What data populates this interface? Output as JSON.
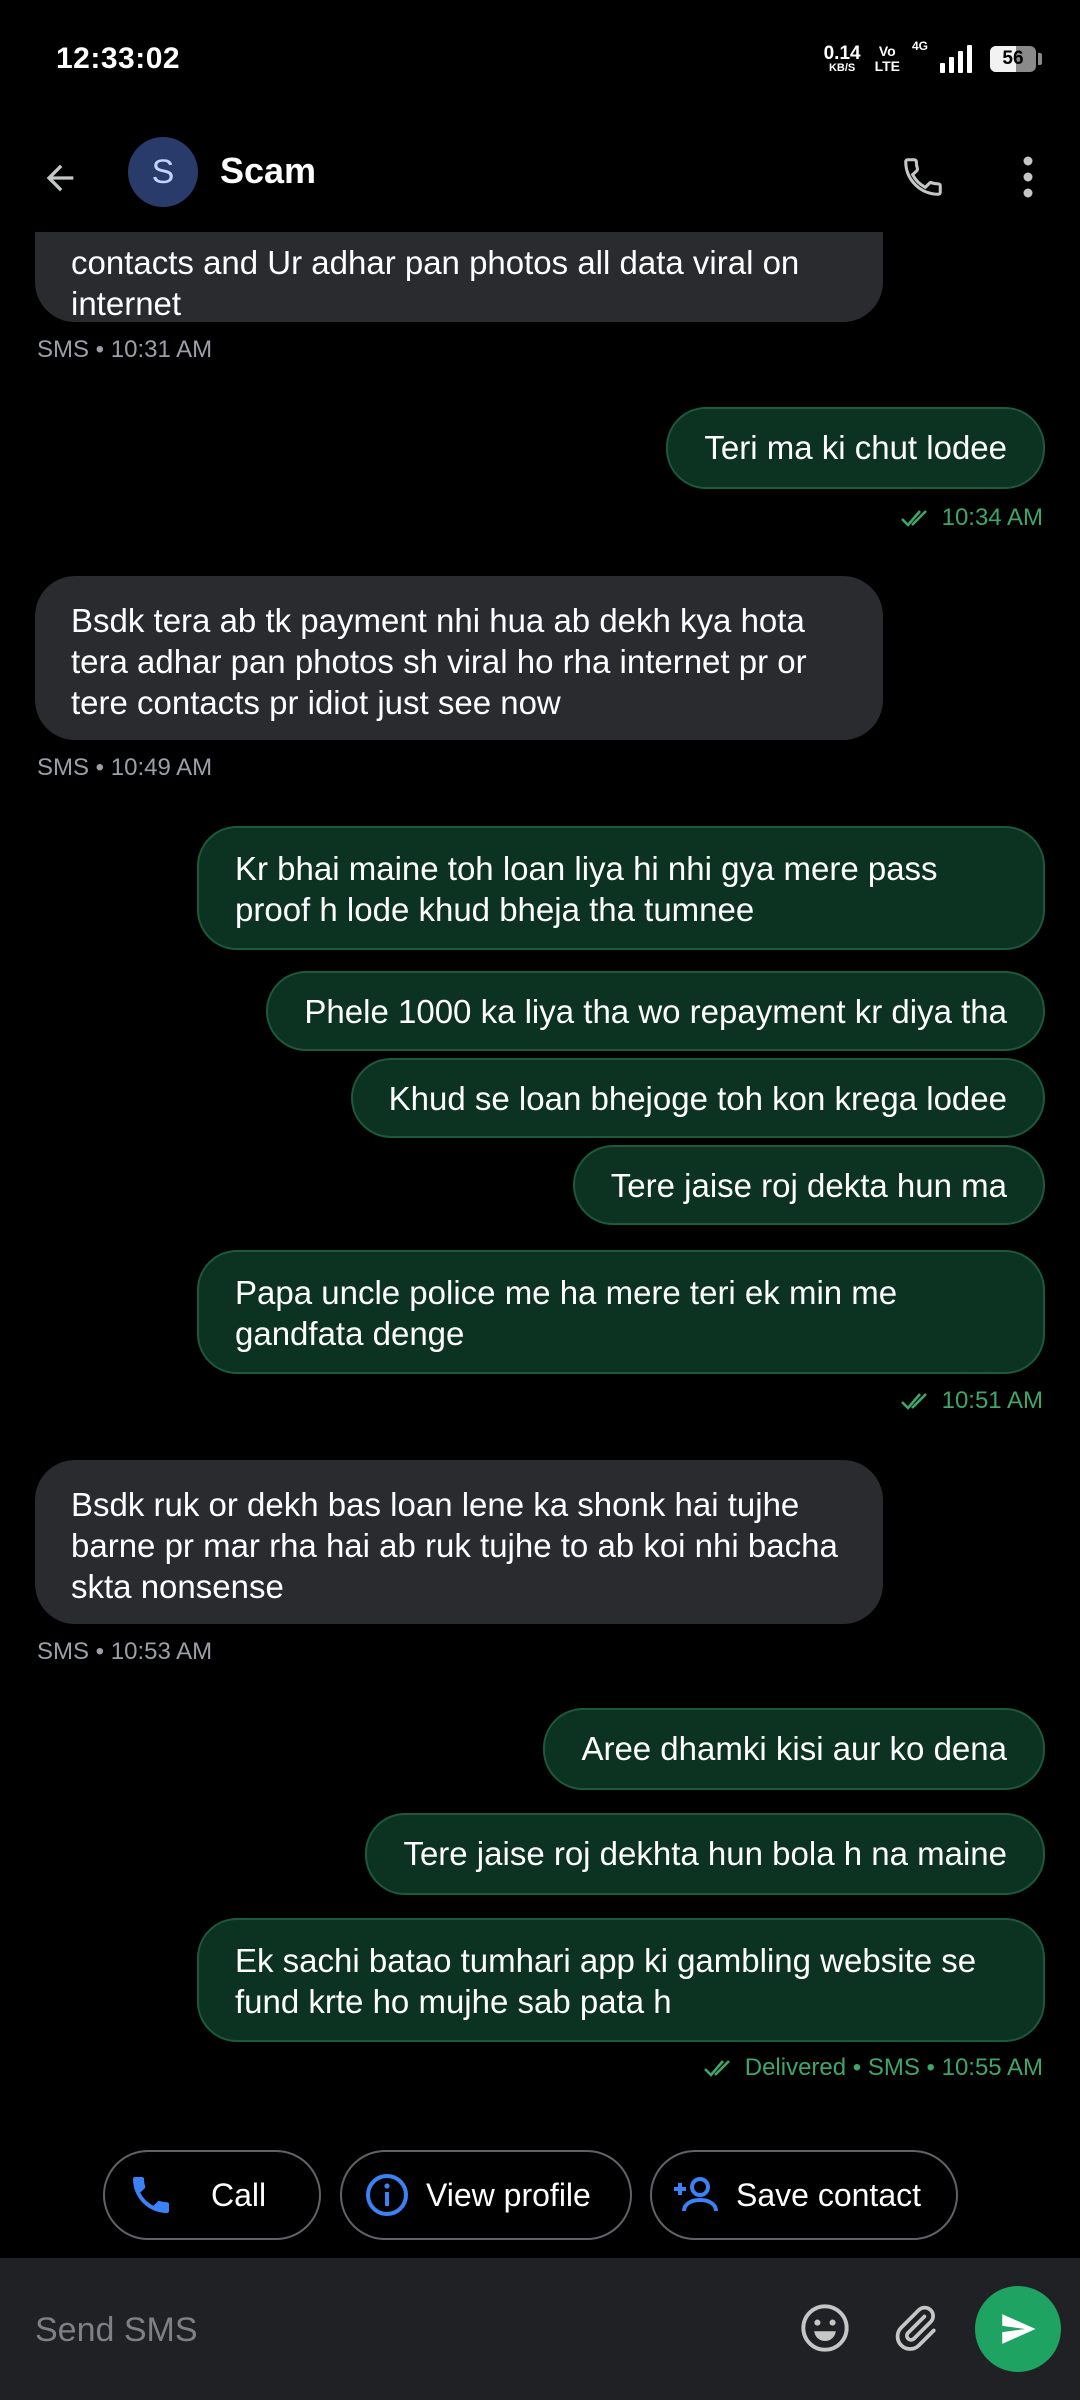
{
  "status_bar": {
    "time": "12:33:02",
    "net_speed_value": "0.14",
    "net_speed_unit": "KB/S",
    "volte_top": "Vo",
    "volte_bottom": "LTE",
    "network": "4G",
    "battery": "56",
    "battery_level": 0.56
  },
  "header": {
    "avatar_letter": "S",
    "contact_name": "Scam",
    "avatar_color": "#283b6a"
  },
  "messages": [
    {
      "direction": "in",
      "text": "contacts and Ur adhar pan photos all data viral on internet",
      "meta": "SMS • 10:31 AM"
    },
    {
      "direction": "out",
      "text": "Teri ma ki chut lodee",
      "meta": "10:34 AM"
    },
    {
      "direction": "in",
      "text": "Bsdk tera ab tk payment nhi hua ab dekh kya hota tera adhar pan photos sh viral ho rha internet pr or tere contacts pr idiot just see now",
      "meta": "SMS • 10:49 AM"
    },
    {
      "direction": "out",
      "text": "Kr bhai maine toh loan liya hi nhi gya mere pass proof h lode khud bheja tha tumnee"
    },
    {
      "direction": "out",
      "text": "Phele 1000 ka liya tha wo repayment kr diya tha"
    },
    {
      "direction": "out",
      "text": "Khud se loan bhejoge toh kon krega lodee"
    },
    {
      "direction": "out",
      "text": "Tere jaise roj dekta hun ma"
    },
    {
      "direction": "out",
      "text": "Papa uncle police me ha mere teri ek min me gandfata denge",
      "meta": "10:51 AM"
    },
    {
      "direction": "in",
      "text": "Bsdk ruk or dekh bas loan lene ka shonk hai tujhe barne pr mar rha hai ab ruk tujhe to ab koi nhi bacha skta nonsense",
      "meta": "SMS • 10:53 AM"
    },
    {
      "direction": "out",
      "text": "Aree dhamki kisi aur ko dena"
    },
    {
      "direction": "out",
      "text": "Tere jaise roj dekhta hun bola h na maine"
    },
    {
      "direction": "out",
      "text": "Ek sachi batao tumhari app ki gambling website se fund krte ho mujhe sab pata h",
      "meta": "Delivered • SMS • 10:55 AM"
    }
  ],
  "actions": {
    "call": "Call",
    "view_profile": "View profile",
    "save_contact": "Save contact"
  },
  "compose": {
    "placeholder": "Send SMS"
  },
  "colors": {
    "incoming_bubble": "#2a2b2f",
    "outgoing_bubble": "#0c3322",
    "accent_blue": "#3b82f6",
    "send_green": "#1ea362",
    "delivered_green": "#3fa66a"
  },
  "icons": {
    "back": "arrow-back-icon",
    "call": "phone-icon",
    "more": "more-vert-icon",
    "delivered": "double-check-icon",
    "emoji": "emoji-icon",
    "attach": "paperclip-icon",
    "send": "send-icon",
    "info": "info-icon",
    "add_person": "person-add-icon"
  }
}
